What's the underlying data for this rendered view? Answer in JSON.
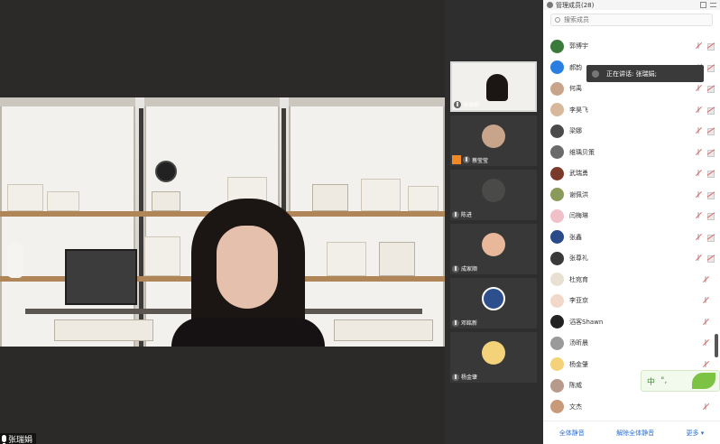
{
  "main_speaker": {
    "name": "张瑞娟"
  },
  "thumbnails": [
    {
      "name": "张瑞娟",
      "color": "#f2f0ec"
    },
    {
      "name": "蔡莹莹",
      "color": "#c8a58a"
    },
    {
      "name": "陈进",
      "color": "#4a4a48"
    },
    {
      "name": "成家顺",
      "color": "#e9b79a"
    },
    {
      "name": "邓銘新",
      "color": "#2d4f8e"
    },
    {
      "name": "杨金肇",
      "color": "#f3d27a"
    }
  ],
  "panel": {
    "title": "管理成员(28)",
    "search_placeholder": "搜索成员",
    "tooltip": "正在讲话: 张瑞娟;",
    "members": [
      {
        "name": "郭博宇",
        "color": "#3b7a3b"
      },
      {
        "name": "郝韵",
        "color": "#2a7de1"
      },
      {
        "name": "何禹",
        "color": "#c8a58a"
      },
      {
        "name": "李昊飞",
        "color": "#d8b89a"
      },
      {
        "name": "梁娜",
        "color": "#4a4a4a"
      },
      {
        "name": "维瑀贝策",
        "color": "#6a6a6a"
      },
      {
        "name": "武瑞勇",
        "color": "#7a3a2a"
      },
      {
        "name": "谢佩洪",
        "color": "#8a9a5a"
      },
      {
        "name": "闫梅琳",
        "color": "#f0c0c8"
      },
      {
        "name": "张鑫",
        "color": "#2a4a8a"
      },
      {
        "name": "张尊礼",
        "color": "#3a3a3a"
      },
      {
        "name": "杜宛育",
        "color": "#e8e0d0"
      },
      {
        "name": "李亚京",
        "color": "#f2d8c8"
      },
      {
        "name": "滔客Shawn",
        "color": "#222222"
      },
      {
        "name": "汤昕晨",
        "color": "#9a9a9a"
      },
      {
        "name": "杨金肇",
        "color": "#f3d27a"
      },
      {
        "name": "陈威",
        "color": "#b89a8a"
      },
      {
        "name": "文杰",
        "color": "#c89a7a"
      }
    ],
    "footer": {
      "mute_all": "全体静音",
      "unmute_all": "解除全体静音",
      "more": "更多 ▾"
    }
  },
  "ime": {
    "label": "中",
    "extra": "°,"
  }
}
